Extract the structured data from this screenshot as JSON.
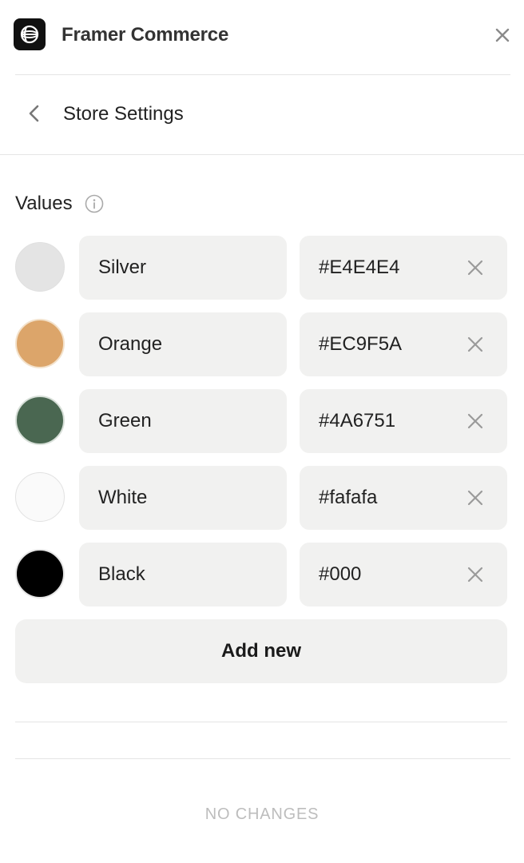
{
  "header": {
    "title": "Framer Commerce",
    "logo_icon": "globe-icon",
    "close_icon": "close-icon"
  },
  "nav": {
    "title": "Store Settings",
    "back_icon": "chevron-left-icon"
  },
  "values": {
    "label": "Values",
    "info_icon": "info-icon",
    "items": [
      {
        "name": "Silver",
        "hex": "#E4E4E4",
        "swatch": "#E4E4E4"
      },
      {
        "name": "Orange",
        "hex": "#EC9F5A",
        "swatch": "#DCA56A"
      },
      {
        "name": "Green",
        "hex": "#4A6751",
        "swatch": "#4A6751"
      },
      {
        "name": "White",
        "hex": "#fafafa",
        "swatch": "#fafafa"
      },
      {
        "name": "Black",
        "hex": "#000",
        "swatch": "#000000"
      }
    ],
    "add_label": "Add new"
  },
  "footer": {
    "status": "NO CHANGES"
  },
  "colors": {
    "field_bg": "#f1f1f0",
    "divider": "#e5e5e5",
    "status_text": "#bdbdbd"
  }
}
